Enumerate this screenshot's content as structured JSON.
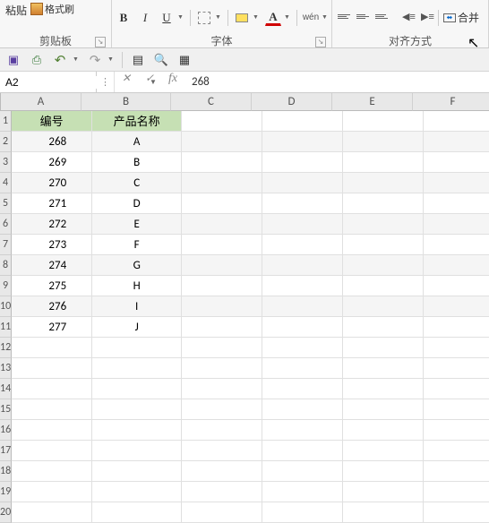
{
  "ribbon": {
    "clipboard": {
      "paste": "粘贴",
      "format_painter": "格式刷",
      "label": "剪贴板"
    },
    "font": {
      "label": "字体",
      "wen": "wén",
      "bold": "B",
      "italic": "I",
      "underline": "U",
      "font_color": "A"
    },
    "align": {
      "label": "对齐方式",
      "merge": "合并"
    }
  },
  "formula_bar": {
    "name_box": "A2",
    "formula": "268",
    "cancel": "✕",
    "accept": "✓",
    "fx": "fx"
  },
  "columns": [
    "A",
    "B",
    "C",
    "D",
    "E",
    "F"
  ],
  "row_numbers": [
    1,
    2,
    3,
    4,
    5,
    6,
    7,
    8,
    9,
    10,
    11,
    12,
    13,
    14,
    15,
    16,
    17,
    18,
    19,
    20
  ],
  "headers": {
    "a": "编号",
    "b": "产品名称"
  },
  "rows": [
    {
      "a": "268",
      "b": "A"
    },
    {
      "a": "269",
      "b": "B"
    },
    {
      "a": "270",
      "b": "C"
    },
    {
      "a": "271",
      "b": "D"
    },
    {
      "a": "272",
      "b": "E"
    },
    {
      "a": "273",
      "b": "F"
    },
    {
      "a": "274",
      "b": "G"
    },
    {
      "a": "275",
      "b": "H"
    },
    {
      "a": "276",
      "b": "I"
    },
    {
      "a": "277",
      "b": "J"
    }
  ]
}
